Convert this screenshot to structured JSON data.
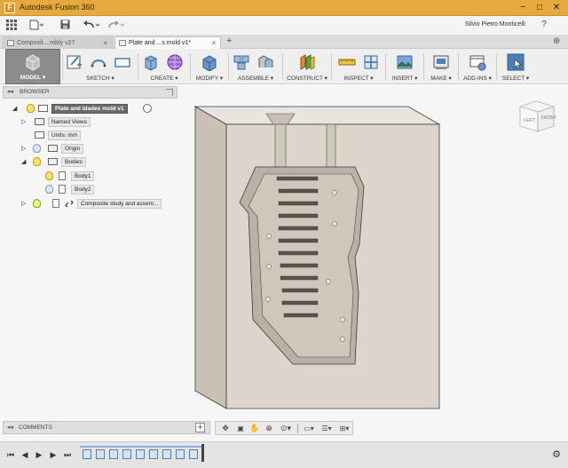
{
  "window": {
    "title": "Autodesk Fusion 360",
    "controls": {
      "minimize": "−",
      "maximize": "□",
      "close": "✕"
    }
  },
  "quick_access": {
    "user_name": "Silvio Pietro Monticelli",
    "help": "?"
  },
  "tabs": [
    {
      "label": "Composit....mbly v27",
      "active": false
    },
    {
      "label": "Plate and ...s mold v1*",
      "active": true
    }
  ],
  "tab_add": "+",
  "toolbar": {
    "groups": [
      {
        "label": "MODEL ▾",
        "active": true
      },
      {
        "label": "SKETCH ▾"
      },
      {
        "label": "CREATE ▾"
      },
      {
        "label": "MODIFY ▾"
      },
      {
        "label": "ASSEMBLE ▾"
      },
      {
        "label": "CONSTRUCT ▾"
      },
      {
        "label": "INSPECT ▾"
      },
      {
        "label": "INSERT ▾"
      },
      {
        "label": "MAKE ▾"
      },
      {
        "label": "ADD-INS ▾"
      },
      {
        "label": "SELECT ▾"
      }
    ]
  },
  "browser": {
    "title": "BROWSER",
    "tree": [
      {
        "label": "Plate and blades mold v1"
      },
      {
        "label": "Named Views"
      },
      {
        "label": "Units: mm"
      },
      {
        "label": "Origin"
      },
      {
        "label": "Bodies"
      },
      {
        "label": "Body1"
      },
      {
        "label": "Body2"
      },
      {
        "label": "Composite study and assem..."
      }
    ]
  },
  "comments": {
    "title": "COMMENTS"
  },
  "viewcube": {
    "left": "LEFT",
    "front": "FRONT"
  },
  "colors": {
    "title_bar": "#e5a93d",
    "accent_blue": "#4a7fb4",
    "mold_face": "#ddd6cc",
    "viewport_bg": "#f6f6f6"
  }
}
